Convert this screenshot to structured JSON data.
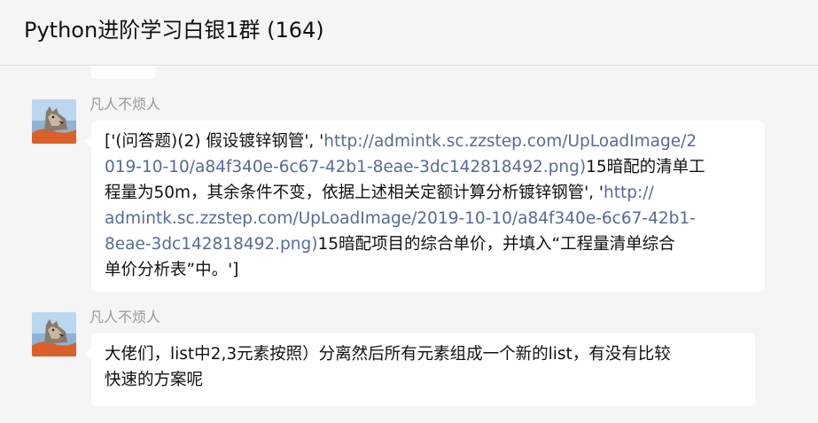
{
  "header": {
    "title": "Python进阶学习白银1群 (164)"
  },
  "messages": [
    {
      "sender": "凡人不烦人",
      "avatar_icon": "wolf-avatar",
      "lines": [
        [
          {
            "t": "['(问答题)(2) 假设镀锌钢管', '"
          },
          {
            "t": "http://admintk.sc.zzstep.com/UpLoadImage/2",
            "link": true
          }
        ],
        [
          {
            "t": "019-10-10/a84f340e-6c67-42b1-8eae-3dc142818492.png)",
            "link": true
          },
          {
            "t": "15暗配的清单工"
          }
        ],
        [
          {
            "t": "程量为50m，其余条件不变，依据上述相关定额计算分析镀锌钢管', '"
          },
          {
            "t": "http://",
            "link": true
          }
        ],
        [
          {
            "t": "admintk.sc.zzstep.com/UpLoadImage/2019-10-10/a84f340e-6c67-42b1-",
            "link": true
          }
        ],
        [
          {
            "t": "8eae-3dc142818492.png)",
            "link": true
          },
          {
            "t": "15暗配项目的综合单价，并填入“工程量清单综合"
          }
        ],
        [
          {
            "t": "单价分析表”中。']"
          }
        ]
      ]
    },
    {
      "sender": "凡人不烦人",
      "avatar_icon": "wolf-avatar",
      "lines": [
        [
          {
            "t": "大佬们，list中2,3元素按照）分离然后所有元素组成一个新的list，有没有比较"
          }
        ],
        [
          {
            "t": "快速的方案呢"
          }
        ]
      ]
    }
  ],
  "colors": {
    "link": "#576b95",
    "background": "#f5f5f5",
    "bubble": "#ffffff",
    "sender": "#999999"
  }
}
